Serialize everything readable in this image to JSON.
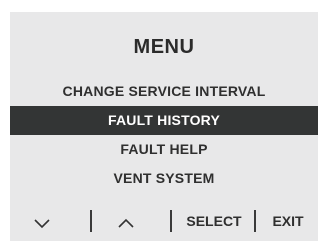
{
  "menu": {
    "title": "MENU",
    "items": [
      {
        "label": "CHANGE SERVICE INTERVAL"
      },
      {
        "label": "FAULT HISTORY",
        "selected": true
      },
      {
        "label": "FAULT HELP"
      },
      {
        "label": "VENT SYSTEM"
      }
    ]
  },
  "softkeys": {
    "down_icon": "chevron-down-icon",
    "up_icon": "chevron-up-icon",
    "select_label": "SELECT",
    "exit_label": "EXIT"
  },
  "colors": {
    "screen_background": "#e8e8e9",
    "selection_background": "#333535",
    "selection_text": "#ffffff",
    "text": "#2f2f2f"
  }
}
